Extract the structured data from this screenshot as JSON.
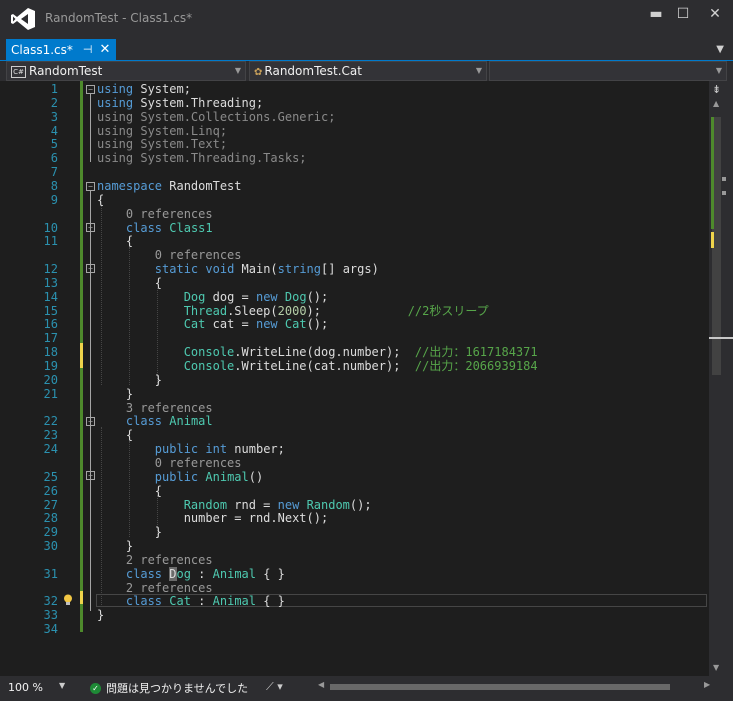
{
  "window": {
    "title": "RandomTest - Class1.cs*",
    "minimize": "▬",
    "maximize": "☐",
    "close": "✕"
  },
  "tab": {
    "label": "Class1.cs*",
    "pin": "⊣",
    "close": "✕"
  },
  "nav": {
    "project": "RandomTest",
    "member": "RandomTest.Cat",
    "project_icon": "C#"
  },
  "status": {
    "zoom": "100 %",
    "issues": "問題は見つかりませんでした"
  },
  "editor": {
    "lines": [
      {
        "n": "1",
        "tokens": [
          {
            "t": "using",
            "c": "kw"
          },
          {
            "t": " System;",
            "c": "plain"
          }
        ]
      },
      {
        "n": "2",
        "tokens": [
          {
            "t": "using",
            "c": "kw"
          },
          {
            "t": " System.Threading;",
            "c": "plain"
          }
        ]
      },
      {
        "n": "3",
        "tokens": [
          {
            "t": "using",
            "c": "dim"
          },
          {
            "t": " System.Collections.Generic;",
            "c": "dim"
          }
        ]
      },
      {
        "n": "4",
        "tokens": [
          {
            "t": "using",
            "c": "dim"
          },
          {
            "t": " System.Linq;",
            "c": "dim"
          }
        ]
      },
      {
        "n": "5",
        "tokens": [
          {
            "t": "using",
            "c": "dim"
          },
          {
            "t": " System.Text;",
            "c": "dim"
          }
        ]
      },
      {
        "n": "6",
        "tokens": [
          {
            "t": "using",
            "c": "dim"
          },
          {
            "t": " System.Threading.Tasks;",
            "c": "dim"
          }
        ]
      },
      {
        "n": "7",
        "tokens": []
      },
      {
        "n": "8",
        "tokens": [
          {
            "t": "namespace",
            "c": "kw"
          },
          {
            "t": " RandomTest",
            "c": "plain"
          }
        ]
      },
      {
        "n": "9",
        "tokens": [
          {
            "t": "{",
            "c": "plain"
          }
        ]
      },
      {
        "n": "",
        "ref": true,
        "tokens": [
          {
            "t": "    0 references",
            "c": "ref"
          }
        ]
      },
      {
        "n": "10",
        "tokens": [
          {
            "t": "    ",
            "c": "plain"
          },
          {
            "t": "class",
            "c": "kw"
          },
          {
            "t": " ",
            "c": "plain"
          },
          {
            "t": "Class1",
            "c": "type"
          }
        ]
      },
      {
        "n": "11",
        "tokens": [
          {
            "t": "    {",
            "c": "plain"
          }
        ]
      },
      {
        "n": "",
        "ref": true,
        "tokens": [
          {
            "t": "        0 references",
            "c": "ref"
          }
        ]
      },
      {
        "n": "12",
        "tokens": [
          {
            "t": "        ",
            "c": "plain"
          },
          {
            "t": "static",
            "c": "kw"
          },
          {
            "t": " ",
            "c": "plain"
          },
          {
            "t": "void",
            "c": "kw"
          },
          {
            "t": " Main(",
            "c": "plain"
          },
          {
            "t": "string",
            "c": "kw"
          },
          {
            "t": "[] args)",
            "c": "plain"
          }
        ]
      },
      {
        "n": "13",
        "tokens": [
          {
            "t": "        {",
            "c": "plain"
          }
        ]
      },
      {
        "n": "14",
        "tokens": [
          {
            "t": "            ",
            "c": "plain"
          },
          {
            "t": "Dog",
            "c": "type"
          },
          {
            "t": " dog = ",
            "c": "plain"
          },
          {
            "t": "new",
            "c": "kw"
          },
          {
            "t": " ",
            "c": "plain"
          },
          {
            "t": "Dog",
            "c": "type"
          },
          {
            "t": "();",
            "c": "plain"
          }
        ]
      },
      {
        "n": "15",
        "tokens": [
          {
            "t": "            ",
            "c": "plain"
          },
          {
            "t": "Thread",
            "c": "type"
          },
          {
            "t": ".Sleep(",
            "c": "plain"
          },
          {
            "t": "2000",
            "c": "num"
          },
          {
            "t": ");            ",
            "c": "plain"
          },
          {
            "t": "//2秒スリープ",
            "c": "cm"
          }
        ]
      },
      {
        "n": "16",
        "tokens": [
          {
            "t": "            ",
            "c": "plain"
          },
          {
            "t": "Cat",
            "c": "type"
          },
          {
            "t": " cat = ",
            "c": "plain"
          },
          {
            "t": "new",
            "c": "kw"
          },
          {
            "t": " ",
            "c": "plain"
          },
          {
            "t": "Cat",
            "c": "type"
          },
          {
            "t": "();",
            "c": "plain"
          }
        ]
      },
      {
        "n": "17",
        "tokens": []
      },
      {
        "n": "18",
        "tokens": [
          {
            "t": "            ",
            "c": "plain"
          },
          {
            "t": "Console",
            "c": "type"
          },
          {
            "t": ".WriteLine(dog.number);  ",
            "c": "plain"
          },
          {
            "t": "//出力：1617184371",
            "c": "cm"
          }
        ]
      },
      {
        "n": "19",
        "tokens": [
          {
            "t": "            ",
            "c": "plain"
          },
          {
            "t": "Console",
            "c": "type"
          },
          {
            "t": ".WriteLine(cat.number);  ",
            "c": "plain"
          },
          {
            "t": "//出力：2066939184",
            "c": "cm"
          }
        ]
      },
      {
        "n": "20",
        "tokens": [
          {
            "t": "        }",
            "c": "plain"
          }
        ]
      },
      {
        "n": "21",
        "tokens": [
          {
            "t": "    }",
            "c": "plain"
          }
        ]
      },
      {
        "n": "",
        "ref": true,
        "tokens": [
          {
            "t": "    3 references",
            "c": "ref"
          }
        ]
      },
      {
        "n": "22",
        "tokens": [
          {
            "t": "    ",
            "c": "plain"
          },
          {
            "t": "class",
            "c": "kw"
          },
          {
            "t": " ",
            "c": "plain"
          },
          {
            "t": "Animal",
            "c": "type"
          }
        ]
      },
      {
        "n": "23",
        "tokens": [
          {
            "t": "    {",
            "c": "plain"
          }
        ]
      },
      {
        "n": "24",
        "tokens": [
          {
            "t": "        ",
            "c": "plain"
          },
          {
            "t": "public",
            "c": "kw"
          },
          {
            "t": " ",
            "c": "plain"
          },
          {
            "t": "int",
            "c": "kw"
          },
          {
            "t": " number;",
            "c": "plain"
          }
        ]
      },
      {
        "n": "",
        "ref": true,
        "tokens": [
          {
            "t": "        0 references",
            "c": "ref"
          }
        ]
      },
      {
        "n": "25",
        "tokens": [
          {
            "t": "        ",
            "c": "plain"
          },
          {
            "t": "public",
            "c": "kw"
          },
          {
            "t": " ",
            "c": "plain"
          },
          {
            "t": "Animal",
            "c": "type"
          },
          {
            "t": "()",
            "c": "plain"
          }
        ]
      },
      {
        "n": "26",
        "tokens": [
          {
            "t": "        {",
            "c": "plain"
          }
        ]
      },
      {
        "n": "27",
        "tokens": [
          {
            "t": "            ",
            "c": "plain"
          },
          {
            "t": "Random",
            "c": "type"
          },
          {
            "t": " rnd = ",
            "c": "plain"
          },
          {
            "t": "new",
            "c": "kw"
          },
          {
            "t": " ",
            "c": "plain"
          },
          {
            "t": "Random",
            "c": "type"
          },
          {
            "t": "();",
            "c": "plain"
          }
        ]
      },
      {
        "n": "28",
        "tokens": [
          {
            "t": "            number = rnd.Next();",
            "c": "plain"
          }
        ]
      },
      {
        "n": "29",
        "tokens": [
          {
            "t": "        }",
            "c": "plain"
          }
        ]
      },
      {
        "n": "30",
        "tokens": [
          {
            "t": "    }",
            "c": "plain"
          }
        ]
      },
      {
        "n": "",
        "ref": true,
        "tokens": [
          {
            "t": "    2 references",
            "c": "ref"
          }
        ]
      },
      {
        "n": "31",
        "tokens": [
          {
            "t": "    ",
            "c": "plain"
          },
          {
            "t": "class",
            "c": "kw"
          },
          {
            "t": " ",
            "c": "plain"
          },
          {
            "t": "D",
            "c": "badge"
          },
          {
            "t": "og",
            "c": "type"
          },
          {
            "t": " : ",
            "c": "plain"
          },
          {
            "t": "Animal",
            "c": "type"
          },
          {
            "t": " { }",
            "c": "plain"
          }
        ]
      },
      {
        "n": "",
        "ref": true,
        "tokens": [
          {
            "t": "    2 references",
            "c": "ref"
          }
        ]
      },
      {
        "n": "32",
        "tokens": [
          {
            "t": "    ",
            "c": "plain"
          },
          {
            "t": "class",
            "c": "kw"
          },
          {
            "t": " ",
            "c": "plain"
          },
          {
            "t": "Cat",
            "c": "type"
          },
          {
            "t": " : ",
            "c": "plain"
          },
          {
            "t": "Animal",
            "c": "type"
          },
          {
            "t": " { }",
            "c": "plain"
          }
        ]
      },
      {
        "n": "33",
        "tokens": [
          {
            "t": "}",
            "c": "plain"
          }
        ]
      },
      {
        "n": "34",
        "tokens": []
      }
    ]
  }
}
